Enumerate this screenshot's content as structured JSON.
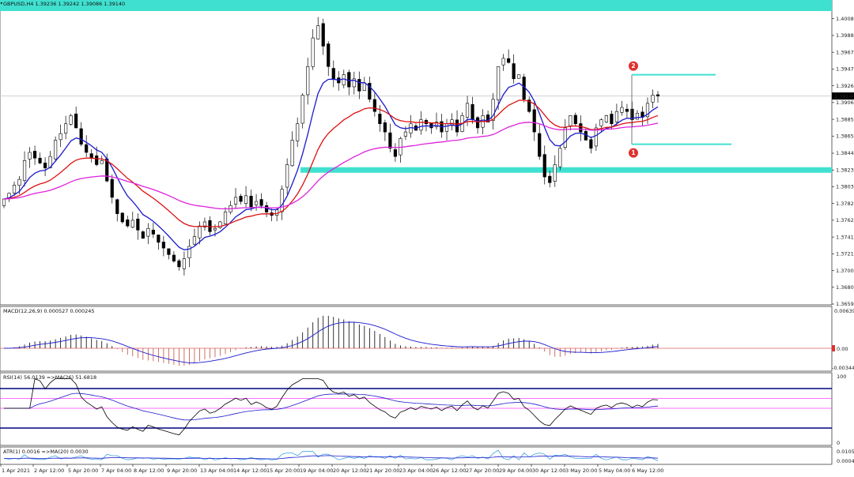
{
  "chart_data": {
    "type": "candlestick",
    "symbol_header": "GBPUSD,H4  1.39236 1.39242 1.39086 1.39140",
    "current_price_label": "1.39140",
    "y_ticks": [
      "1.40085",
      "1.39880",
      "1.39675",
      "1.39470",
      "1.39265",
      "1.39060",
      "1.38855",
      "1.38650",
      "1.38440",
      "1.38235",
      "1.38030",
      "1.37825",
      "1.37620",
      "1.37415",
      "1.37210",
      "1.37005",
      "1.36800",
      "1.36595"
    ],
    "ylim": [
      1.36595,
      1.4015
    ],
    "x_ticks": [
      "1 Apr 2021",
      "2 Apr 12:00",
      "5 Apr 20:00",
      "7 Apr 04:00",
      "8 Apr 12:00",
      "9 Apr 20:00",
      "13 Apr 04:00",
      "14 Apr 12:00",
      "15 Apr 20:00",
      "19 Apr 04:00",
      "20 Apr 12:00",
      "21 Apr 20:00",
      "23 Apr 04:00",
      "26 Apr 12:00",
      "27 Apr 20:00",
      "29 Apr 04:00",
      "30 Apr 12:00",
      "3 May 20:00",
      "5 May 04:00",
      "6 May 12:00"
    ],
    "close_series": [
      1.3788,
      1.3795,
      1.3805,
      1.3812,
      1.3835,
      1.3845,
      1.3838,
      1.3832,
      1.3826,
      1.384,
      1.386,
      1.3868,
      1.388,
      1.389,
      1.3875,
      1.3855,
      1.3845,
      1.3838,
      1.383,
      1.3835,
      1.381,
      1.379,
      1.377,
      1.376,
      1.3755,
      1.3762,
      1.375,
      1.374,
      1.3752,
      1.3745,
      1.3735,
      1.3728,
      1.372,
      1.3712,
      1.3705,
      1.3715,
      1.373,
      1.3742,
      1.3755,
      1.376,
      1.3748,
      1.3752,
      1.376,
      1.3772,
      1.378,
      1.379,
      1.3785,
      1.3792,
      1.3778,
      1.3785,
      1.378,
      1.3772,
      1.3768,
      1.3775,
      1.38,
      1.383,
      1.386,
      1.388,
      1.3915,
      1.395,
      1.3985,
      1.4,
      1.3975,
      1.395,
      1.3935,
      1.393,
      1.394,
      1.3925,
      1.3935,
      1.392,
      1.393,
      1.391,
      1.3895,
      1.388,
      1.387,
      1.385,
      1.384,
      1.3862,
      1.387,
      1.388,
      1.3872,
      1.3885,
      1.388,
      1.3875,
      1.3882,
      1.387,
      1.388,
      1.3885,
      1.387,
      1.389,
      1.3905,
      1.3885,
      1.3875,
      1.389,
      1.3882,
      1.391,
      1.395,
      1.396,
      1.3955,
      1.3935,
      1.394,
      1.391,
      1.3895,
      1.387,
      1.384,
      1.3815,
      1.3808,
      1.383,
      1.385,
      1.3875,
      1.389,
      1.388,
      1.387,
      1.386,
      1.385,
      1.3875,
      1.3885,
      1.389,
      1.388,
      1.3895,
      1.39,
      1.3895,
      1.3885,
      1.3893,
      1.3888,
      1.3905,
      1.3915,
      1.3914
    ],
    "series": [
      {
        "name": "",
        "color": "#1a1acc",
        "period": 8
      },
      {
        "name": "",
        "color": "#dd1111",
        "period": 21
      },
      {
        "name": "",
        "color": "#dd22dd",
        "period": 55
      }
    ],
    "zones": [
      {
        "price": 1.38235,
        "color": "#40e0d0"
      },
      {
        "price": 1.4012,
        "color": "#40e0d0"
      }
    ],
    "annotations": [
      {
        "label": "2",
        "price": 1.394,
        "color": "#e03030"
      },
      {
        "label": "1",
        "price": 1.3855,
        "color": "#e03030"
      }
    ],
    "macd": {
      "label": "MACD(12,26,9) 0.000527 0.000245",
      "ticks": [
        "0.006391",
        "0.00",
        "-0.003445"
      ],
      "ylim": [
        -0.003445,
        0.006391
      ]
    },
    "rsi": {
      "label": "RSI(14) 56.0139  =>MA(26) 51.6818",
      "ticks": [
        "100",
        "0"
      ],
      "levels": [
        30,
        50,
        70
      ],
      "ylim": [
        0,
        100
      ]
    },
    "atr": {
      "label": "ATR(1) 0.0016  =>MA(20) 0.0030",
      "ticks": [
        "0.0105",
        "0.0004"
      ]
    },
    "colors": {
      "bull_body": "#ffffff",
      "bear_body": "#000000",
      "wick": "#000000",
      "macd_hist": "#000000",
      "macd_hist_neg": "#c05040",
      "signal": "#1a1acc",
      "rsi_line": "#000000",
      "rsi_ma": "#1a1acc",
      "rsi_band": "#000080",
      "rsi_mid": "#ff40ff",
      "atr_line": "#3da0e0",
      "atr_ma": "#1a1acc",
      "zero_line": "#e06060",
      "price_line": "#cccccc"
    }
  }
}
